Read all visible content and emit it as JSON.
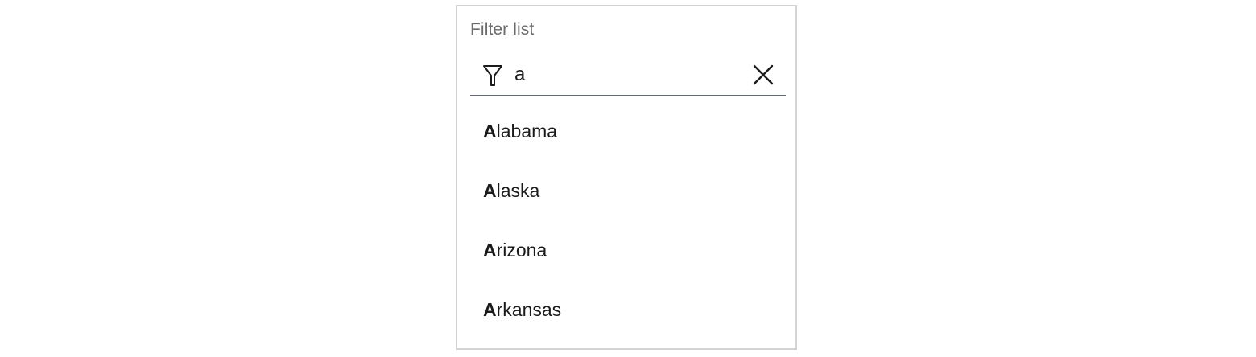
{
  "filter": {
    "label": "Filter list",
    "value": "a",
    "filter_icon": "filter-icon",
    "clear_icon": "close-icon"
  },
  "results": [
    {
      "match": "A",
      "rest": "labama"
    },
    {
      "match": "A",
      "rest": "laska"
    },
    {
      "match": "A",
      "rest": "rizona"
    },
    {
      "match": "A",
      "rest": "rkansas"
    }
  ],
  "colors": {
    "border": "#d4d4d4",
    "underline": "#666a70",
    "label": "#6b6b6b",
    "text": "#1b1b1b"
  }
}
